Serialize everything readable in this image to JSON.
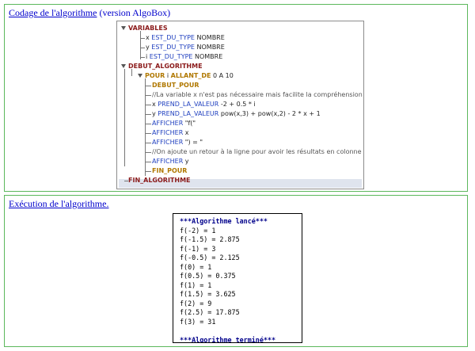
{
  "panel_code": {
    "title_link": "Codage de l'algorithme",
    "title_rest": " (version AlgoBox)"
  },
  "tree": [
    {
      "depth": 0,
      "tri": true,
      "parts": [
        {
          "c": "kw",
          "t": "VARIABLES"
        }
      ]
    },
    {
      "depth": 1,
      "parts": [
        {
          "c": "tx",
          "t": "x "
        },
        {
          "c": "kb",
          "t": "EST_DU_TYPE"
        },
        {
          "c": "tx",
          "t": " NOMBRE"
        }
      ]
    },
    {
      "depth": 1,
      "parts": [
        {
          "c": "tx",
          "t": "y "
        },
        {
          "c": "kb",
          "t": "EST_DU_TYPE"
        },
        {
          "c": "tx",
          "t": " NOMBRE"
        }
      ]
    },
    {
      "depth": 1,
      "parts": [
        {
          "c": "tx",
          "t": "i "
        },
        {
          "c": "kb",
          "t": "EST_DU_TYPE"
        },
        {
          "c": "tx",
          "t": " NOMBRE"
        }
      ]
    },
    {
      "depth": 0,
      "tri": true,
      "parts": [
        {
          "c": "kw",
          "t": "DEBUT_ALGORITHME"
        }
      ]
    },
    {
      "depth": 1,
      "tri": true,
      "parts": [
        {
          "c": "kw2",
          "t": "POUR"
        },
        {
          "c": "tx",
          "t": " i "
        },
        {
          "c": "kw2",
          "t": "ALLANT_DE"
        },
        {
          "c": "tx",
          "t": " 0 A 10"
        }
      ]
    },
    {
      "depth": 2,
      "parts": [
        {
          "c": "kw2",
          "t": "DEBUT_POUR"
        }
      ]
    },
    {
      "depth": 2,
      "parts": [
        {
          "c": "cm",
          "t": "//La variable x n'est pas nécessaire mais facilite la compréhension"
        }
      ]
    },
    {
      "depth": 2,
      "parts": [
        {
          "c": "tx",
          "t": "x "
        },
        {
          "c": "kb",
          "t": "PREND_LA_VALEUR"
        },
        {
          "c": "tx",
          "t": " -2 + 0.5 * i"
        }
      ]
    },
    {
      "depth": 2,
      "parts": [
        {
          "c": "tx",
          "t": "y "
        },
        {
          "c": "kb",
          "t": "PREND_LA_VALEUR"
        },
        {
          "c": "tx",
          "t": " pow(x,3) + pow(x,2) - 2 * x + 1"
        }
      ]
    },
    {
      "depth": 2,
      "parts": [
        {
          "c": "kb",
          "t": "AFFICHER"
        },
        {
          "c": "tx",
          "t": " \"f(\""
        }
      ]
    },
    {
      "depth": 2,
      "parts": [
        {
          "c": "kb",
          "t": "AFFICHER"
        },
        {
          "c": "tx",
          "t": " x"
        }
      ]
    },
    {
      "depth": 2,
      "parts": [
        {
          "c": "kb",
          "t": "AFFICHER"
        },
        {
          "c": "tx",
          "t": " \") = \""
        }
      ]
    },
    {
      "depth": 2,
      "parts": [
        {
          "c": "cm",
          "t": "//On ajoute un retour à la ligne pour avoir les résultats en colonne"
        }
      ]
    },
    {
      "depth": 2,
      "parts": [
        {
          "c": "kb",
          "t": "AFFICHER"
        },
        {
          "c": "tx",
          "t": " y"
        }
      ]
    },
    {
      "depth": 2,
      "parts": [
        {
          "c": "kw2",
          "t": "FIN_POUR"
        }
      ]
    },
    {
      "depth": 0,
      "parts": [
        {
          "c": "kw",
          "t": "FIN_ALGORITHME"
        }
      ]
    }
  ],
  "panel_exec": {
    "title_link": "Exécution de l'algorithme."
  },
  "console": {
    "header": "***Algorithme lancé***",
    "lines": [
      "f(-2) = 1",
      "f(-1.5) = 2.875",
      "f(-1) = 3",
      "f(-0.5) = 2.125",
      "f(0) = 1",
      "f(0.5) = 0.375",
      "f(1) = 1",
      "f(1.5) = 3.625",
      "f(2) = 9",
      "f(2.5) = 17.875",
      "f(3) = 31"
    ],
    "footer": "***Algorithme terminé***"
  }
}
